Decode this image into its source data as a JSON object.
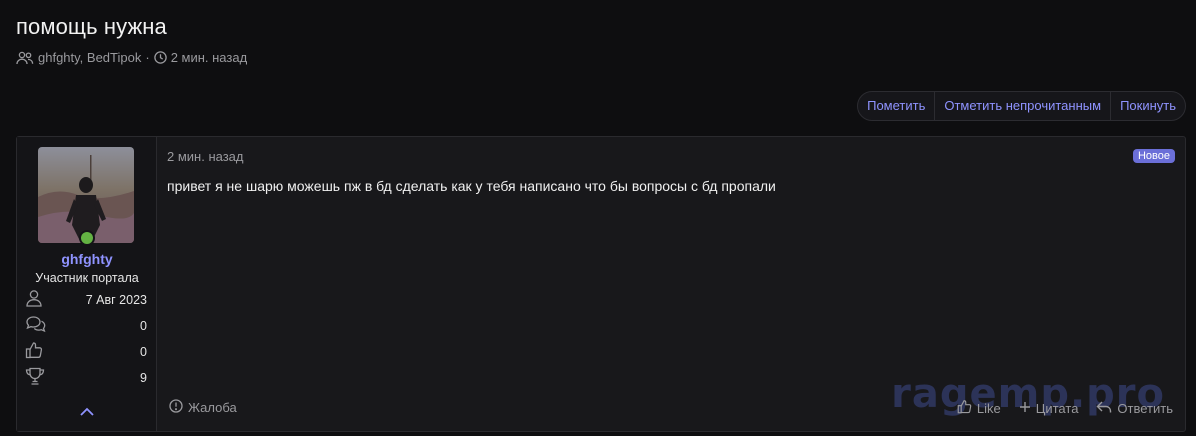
{
  "thread": {
    "title": "помощь нужна",
    "participants": "ghfghty, BedTipok",
    "separator": "·",
    "time": "2 мин. назад"
  },
  "actions": {
    "mark": "Пометить",
    "mark_unread": "Отметить непрочитанным",
    "leave": "Покинуть"
  },
  "post": {
    "user": {
      "name": "ghfghty",
      "title": "Участник портала",
      "joined": "7 Авг 2023",
      "messages": "0",
      "reactions": "0",
      "points": "9"
    },
    "date": "2 мин. назад",
    "badge": "Новое",
    "body": "привет я не шарю можешь пж в бд сделать как у тебя написано что бы вопросы с бд пропали",
    "report": "Жалоба",
    "like": "Like",
    "quote": "Цитата",
    "reply": "Ответить"
  },
  "watermark": "ragemp.pro",
  "colors": {
    "accent": "#8f93ff",
    "badge": "#6b6fd8",
    "online": "#63b243",
    "background": "#0e0e10"
  }
}
